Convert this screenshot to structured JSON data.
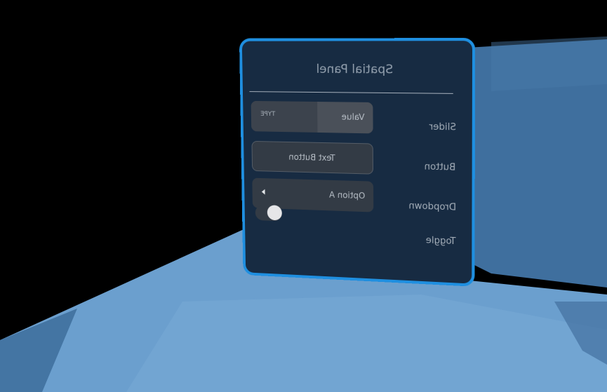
{
  "panel": {
    "title": "Spatial Panel",
    "accent_color": "#1f8fe0",
    "background_color": "#172b42"
  },
  "rows": {
    "slider": {
      "label": "Slider",
      "value_label": "Value",
      "type_label": "TYPE",
      "level": 0.45
    },
    "button": {
      "label": "Button",
      "text": "Text Button"
    },
    "dropdown": {
      "label": "Dropdown",
      "selected": "Option A",
      "icon": "caret-left-icon"
    },
    "toggle": {
      "label": "Toggle",
      "state": "off"
    }
  },
  "environment": {
    "sky_color": "#000000",
    "floor_color": "#6b9fce",
    "wall_color": "#3f6f9e"
  }
}
